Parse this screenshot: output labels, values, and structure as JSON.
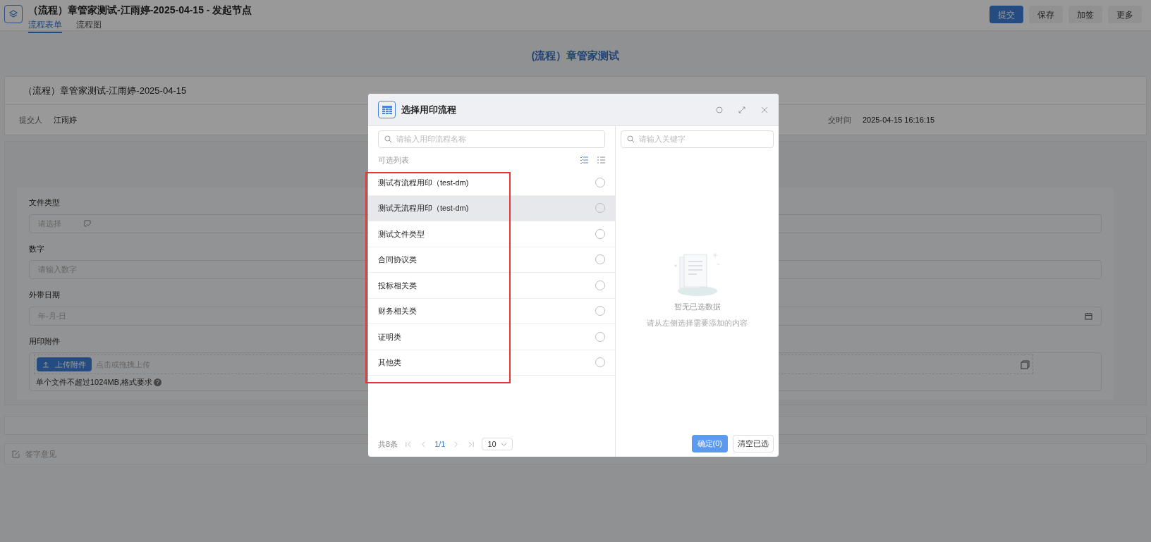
{
  "header": {
    "title": "（流程）章管家测试-江雨婷-2025-04-15 - 发起节点",
    "tabs": [
      {
        "label": "流程表单",
        "selected": true
      },
      {
        "label": "流程图",
        "selected": false
      }
    ],
    "buttons": [
      {
        "label": "提交",
        "kind": "primary"
      },
      {
        "label": "保存",
        "kind": "default"
      },
      {
        "label": "加签",
        "kind": "default"
      },
      {
        "label": "更多",
        "kind": "default"
      }
    ]
  },
  "page_title": "(流程）章管家测试",
  "summary": {
    "title": "（流程）章管家测试-江雨婷-2025-04-15",
    "submitter_label": "提交人",
    "submitter": "江雨婷",
    "time_label": "交时间",
    "time": "2025-04-15 16:16:15"
  },
  "form": {
    "fields": [
      {
        "label": "文件类型",
        "kind": "select",
        "placeholder": "请选择"
      },
      {
        "label": "数字",
        "kind": "text",
        "placeholder": "请输入数字"
      },
      {
        "label": "外带日期",
        "kind": "date",
        "placeholder": "年-月-日"
      },
      {
        "label": "用印附件",
        "kind": "upload",
        "button": "上传附件",
        "hint": "点击或拖拽上传",
        "note": "单个文件不超过1024MB,格式要求",
        "help": "?"
      }
    ]
  },
  "opinion": {
    "label": "签字意见"
  },
  "dialog": {
    "title": "选择用印流程",
    "left": {
      "search_placeholder": "请输入用印流程名称",
      "list_label": "可选列表",
      "items": [
        {
          "label": "测试有流程用印（test-dm)",
          "hovered": false,
          "selected": false
        },
        {
          "label": "测试无流程用印（test-dm)",
          "hovered": true,
          "selected": false
        },
        {
          "label": "测试文件类型",
          "hovered": false,
          "selected": false
        },
        {
          "label": "合同协议类",
          "hovered": false,
          "selected": false
        },
        {
          "label": "投标相关类",
          "hovered": false,
          "selected": false
        },
        {
          "label": "财务相关类",
          "hovered": false,
          "selected": false
        },
        {
          "label": "证明类",
          "hovered": false,
          "selected": false
        },
        {
          "label": "其他类",
          "hovered": false,
          "selected": false
        }
      ],
      "total": "共8条",
      "page": "1/1",
      "page_size": "10"
    },
    "right": {
      "search_placeholder": "请输入关键字",
      "empty_title": "暂无已选数据",
      "empty_hint": "请从左侧选择需要添加的内容",
      "confirm": "确定(0)",
      "clear": "清空已选"
    }
  }
}
